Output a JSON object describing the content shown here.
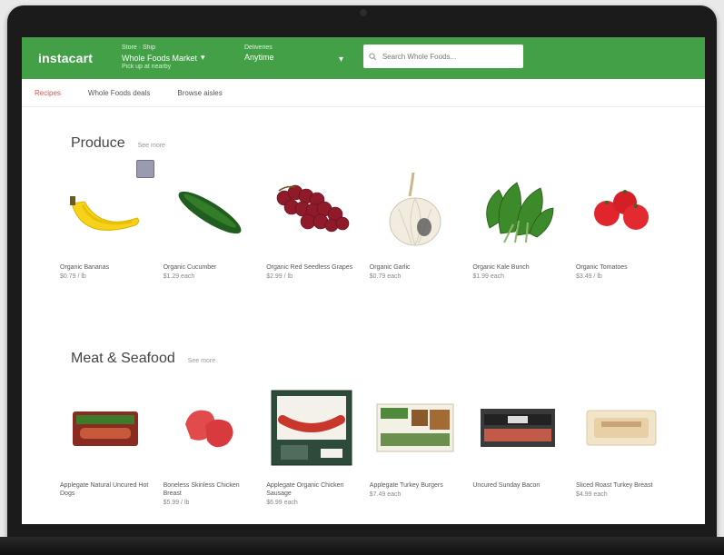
{
  "header": {
    "logo": "instacart",
    "store_label": "Store · Ship",
    "store_name": "Whole Foods Market",
    "store_sub": "Pick up at nearby",
    "delivery_label": "Deliveries",
    "delivery_value": "Anytime",
    "search_placeholder": "Search Whole Foods..."
  },
  "subnav": {
    "items": [
      "Recipes",
      "Whole Foods deals",
      "Browse aisles"
    ]
  },
  "sections": [
    {
      "title": "Produce",
      "see_all": "See more",
      "products": [
        {
          "name": "Organic Bananas",
          "price": "$0.79 / lb"
        },
        {
          "name": "Organic Cucumber",
          "price": "$1.29 each"
        },
        {
          "name": "Organic Red Seedless Grapes",
          "price": "$2.99 / lb"
        },
        {
          "name": "Organic Garlic",
          "price": "$0.79 each"
        },
        {
          "name": "Organic Kale Bunch",
          "price": "$1.99 each"
        },
        {
          "name": "Organic Tomatoes",
          "price": "$3.49 / lb"
        }
      ]
    },
    {
      "title": "Meat & Seafood",
      "see_all": "See more",
      "products": [
        {
          "name": "Applegate Natural Uncured Hot Dogs",
          "price": ""
        },
        {
          "name": "Boneless Skinless Chicken Breast",
          "price": "$5.99 / lb"
        },
        {
          "name": "Applegate Organic Chicken Sausage",
          "price": "$6.99 each"
        },
        {
          "name": "Applegate Turkey Burgers",
          "price": "$7.49 each"
        },
        {
          "name": "Uncured Sunday Bacon",
          "price": ""
        },
        {
          "name": "Sliced Roast Turkey Breast",
          "price": "$4.99 each"
        }
      ]
    }
  ],
  "colors": {
    "brand_green": "#43a047",
    "accent_red": "#d9534f"
  }
}
